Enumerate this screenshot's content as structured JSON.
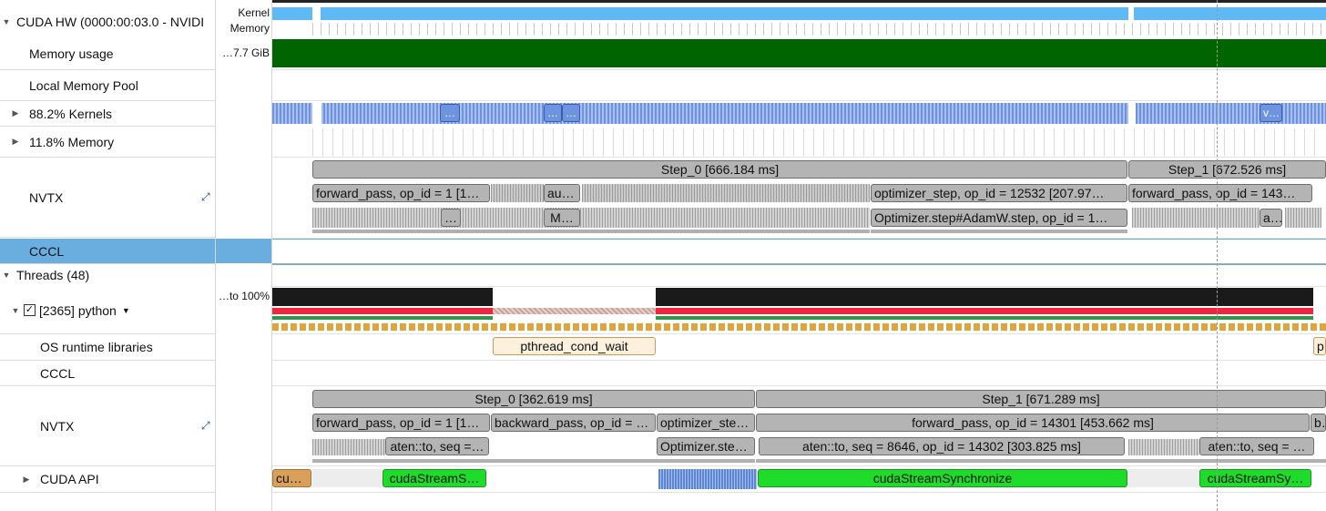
{
  "names": {
    "cuda_hw": "CUDA HW (0000:00:03.0 - NVIDI",
    "memory_usage": "Memory usage",
    "local_pool": "Local Memory Pool",
    "kernels": "88.2% Kernels",
    "memory": "11.8% Memory",
    "nvtx": "NVTX",
    "cccl": "CCCL",
    "threads": "Threads (48)",
    "python": "[2365] python",
    "os_runtime": "OS runtime libraries",
    "cccl2": "CCCL",
    "nvtx2": "NVTX",
    "cuda_api": "CUDA API"
  },
  "info": {
    "kernel": "Kernel",
    "memory": "Memory",
    "mem_usage": "…7.7 GiB",
    "cpu": "…to 100%"
  },
  "gpu_nvtx": {
    "step0": "Step_0 [666.184 ms]",
    "step1": "Step_1 [672.526 ms]",
    "fwd0": "forward_pass, op_id = 1 [1…",
    "aut": "aut…",
    "opt": "optimizer_step, op_id = 12532 [207.97…",
    "fwd1": "forward_pass, op_id = 143…",
    "dots1": "…",
    "m": "M…",
    "optstep": "Optimizer.step#AdamW.step, op_id = 1…",
    "a": "a…"
  },
  "kernels": {
    "dots": "…",
    "v": "v…"
  },
  "os": {
    "pthread": "pthread_cond_wait",
    "p": "p…"
  },
  "cpu_nvtx": {
    "step0": "Step_0 [362.619 ms]",
    "step1": "Step_1 [671.289 ms]",
    "fwd0": "forward_pass, op_id = 1 [1…",
    "bwd": "backward_pass, op_id = …",
    "optste": "optimizer_ste…",
    "fwd1": "forward_pass, op_id = 14301 [453.662 ms]",
    "b": "b…",
    "aten0": "aten::to, seq =…",
    "optste2": "Optimizer.ste…",
    "aten1": "aten::to, seq = 8646, op_id = 14302 [303.825 ms]",
    "aten2": "aten::to, seq = …"
  },
  "cuda_api": {
    "cud": "cud…",
    "sync0": "cudaStreamS…",
    "sync1": "cudaStreamSynchronize",
    "sync2": "cudaStreamSy…"
  },
  "colors": {
    "memory_green": "#006400",
    "kernel_blue": "#5fb9f5",
    "cpu_black": "#1a1a1a",
    "cpu_red": "#f2243e",
    "selection": "#6aaee0"
  }
}
